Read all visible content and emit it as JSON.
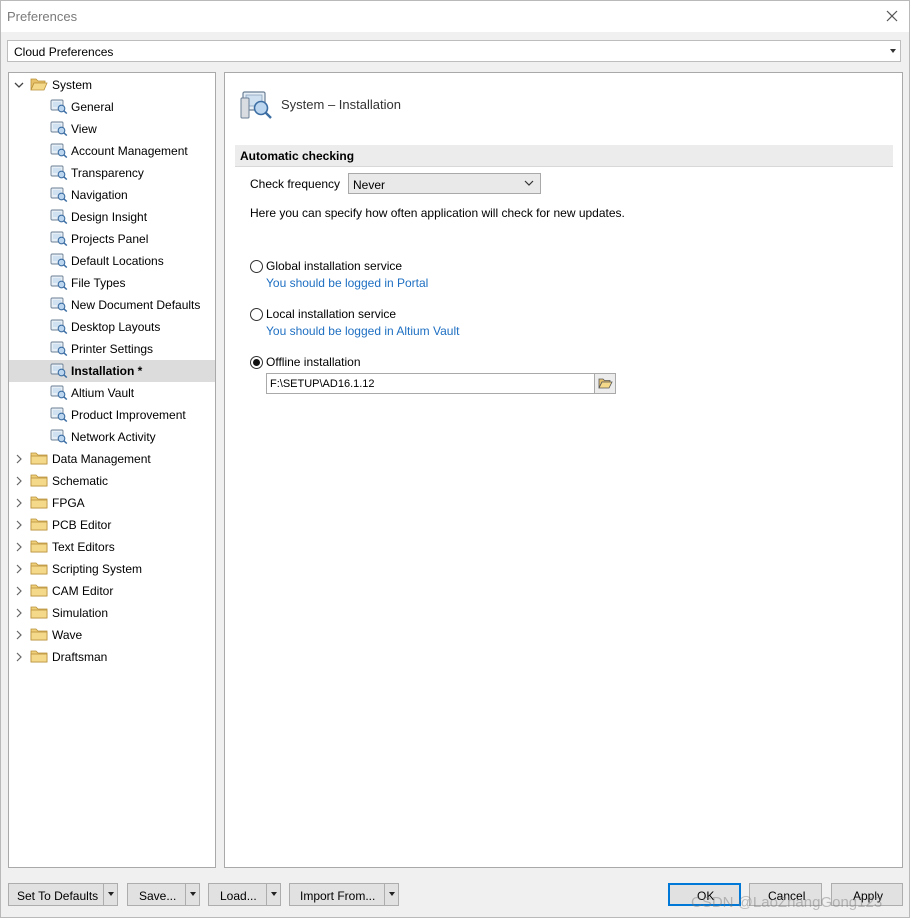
{
  "window": {
    "title": "Preferences"
  },
  "profile": {
    "selected": "Cloud Preferences"
  },
  "tree": {
    "root": "System",
    "system_items": [
      "General",
      "View",
      "Account Management",
      "Transparency",
      "Navigation",
      "Design Insight",
      "Projects Panel",
      "Default Locations",
      "File Types",
      "New Document Defaults",
      "Desktop Layouts",
      "Printer Settings",
      "Installation *",
      "Altium Vault",
      "Product Improvement",
      "Network Activity"
    ],
    "selected_item": "Installation *",
    "other_folders": [
      "Data Management",
      "Schematic",
      "FPGA",
      "PCB Editor",
      "Text Editors",
      "Scripting System",
      "CAM Editor",
      "Simulation",
      "Wave",
      "Draftsman"
    ]
  },
  "panel": {
    "title": "System – Installation",
    "section": "Automatic checking",
    "check_frequency_label": "Check frequency",
    "check_frequency_value": "Never",
    "info": "Here you can specify how often application will check for new updates.",
    "options": [
      {
        "label": "Global installation service",
        "hint": "You should be logged in Portal",
        "checked": false
      },
      {
        "label": "Local installation service",
        "hint": "You should be logged in Altium Vault",
        "checked": false
      },
      {
        "label": "Offline installation",
        "hint": "",
        "checked": true
      }
    ],
    "offline_path": "F:\\SETUP\\AD16.1.12"
  },
  "footer": {
    "set_defaults": "Set To Defaults",
    "save": "Save...",
    "load": "Load...",
    "import_from": "Import From...",
    "ok": "OK",
    "cancel": "Cancel",
    "apply": "Apply"
  },
  "watermark": "CSDN @LaoZhangGong123",
  "colors": {
    "link": "#1e6fc2",
    "selection": "#dcdcdc",
    "primary_border": "#0078d7"
  }
}
